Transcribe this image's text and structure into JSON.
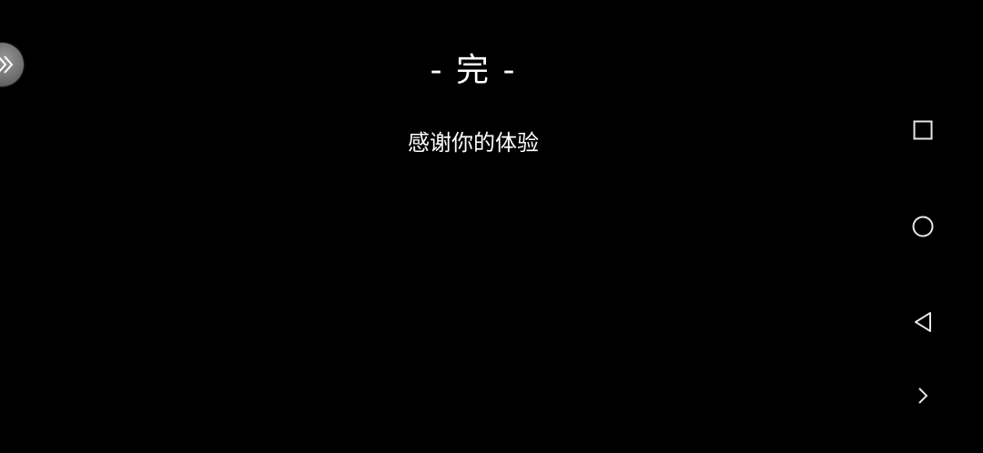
{
  "content": {
    "end_title": "- 完 -",
    "end_subtitle": "感谢你的体验"
  },
  "floating_button": {
    "icon": "double-chevron-right-icon"
  },
  "navigation_bar": {
    "recents_icon": "square-icon",
    "home_icon": "circle-icon",
    "back_icon": "triangle-back-icon",
    "more_icon": "chevron-right-icon"
  },
  "colors": {
    "background": "#000000",
    "text": "#ffffff",
    "nav_icon": "#e6e6e6"
  }
}
